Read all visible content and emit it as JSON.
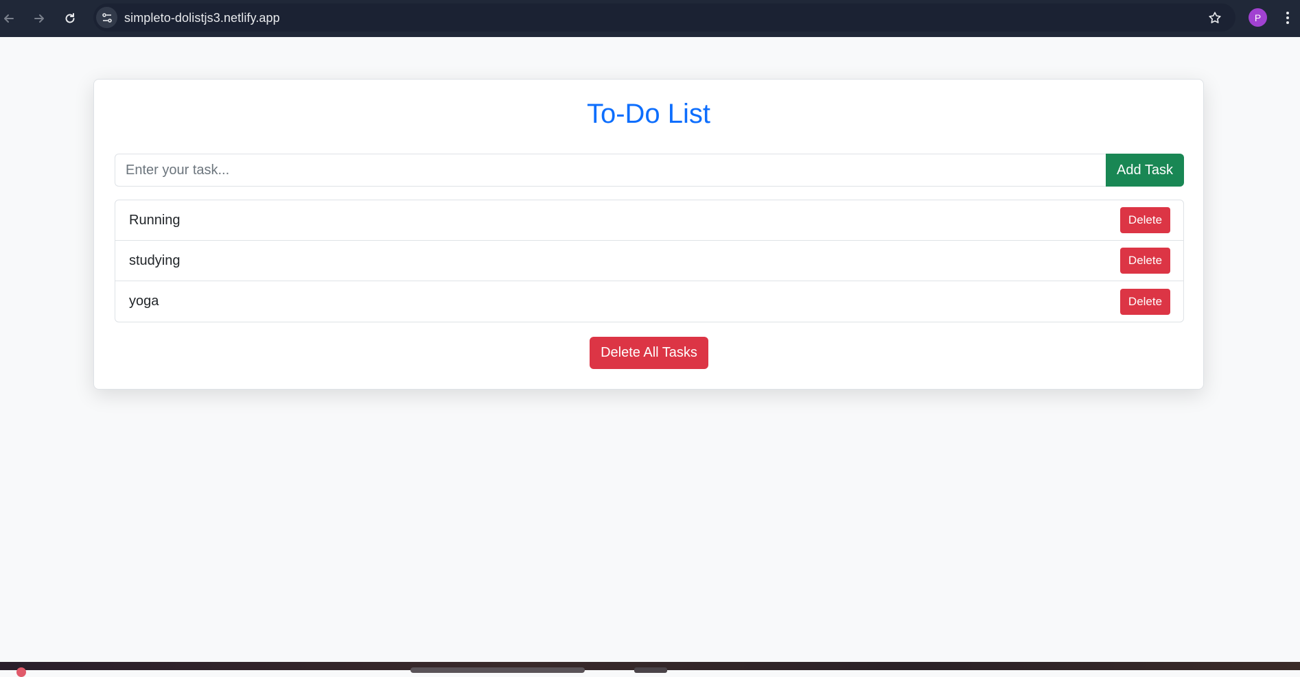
{
  "browser": {
    "url": "simpleto-dolistjs3.netlify.app",
    "profile_initial": "P",
    "icons": {
      "back": "arrow-left-icon",
      "forward": "arrow-right-icon",
      "reload": "reload-icon",
      "site_info": "tune-icon",
      "bookmark": "star-icon",
      "menu": "kebab-menu-icon"
    }
  },
  "app": {
    "title": "To-Do List",
    "input_placeholder": "Enter your task...",
    "input_value": "",
    "add_button": "Add Task",
    "tasks": [
      {
        "text": "Running",
        "delete_label": "Delete"
      },
      {
        "text": "studying",
        "delete_label": "Delete"
      },
      {
        "text": "yoga",
        "delete_label": "Delete"
      }
    ],
    "delete_all_button": "Delete All Tasks"
  },
  "colors": {
    "title": "#0d6efd",
    "add_button": "#198754",
    "delete_button": "#dc3545",
    "page_background": "#f8f9fa",
    "browser_bar": "#202838",
    "avatar": "#a142d1"
  }
}
